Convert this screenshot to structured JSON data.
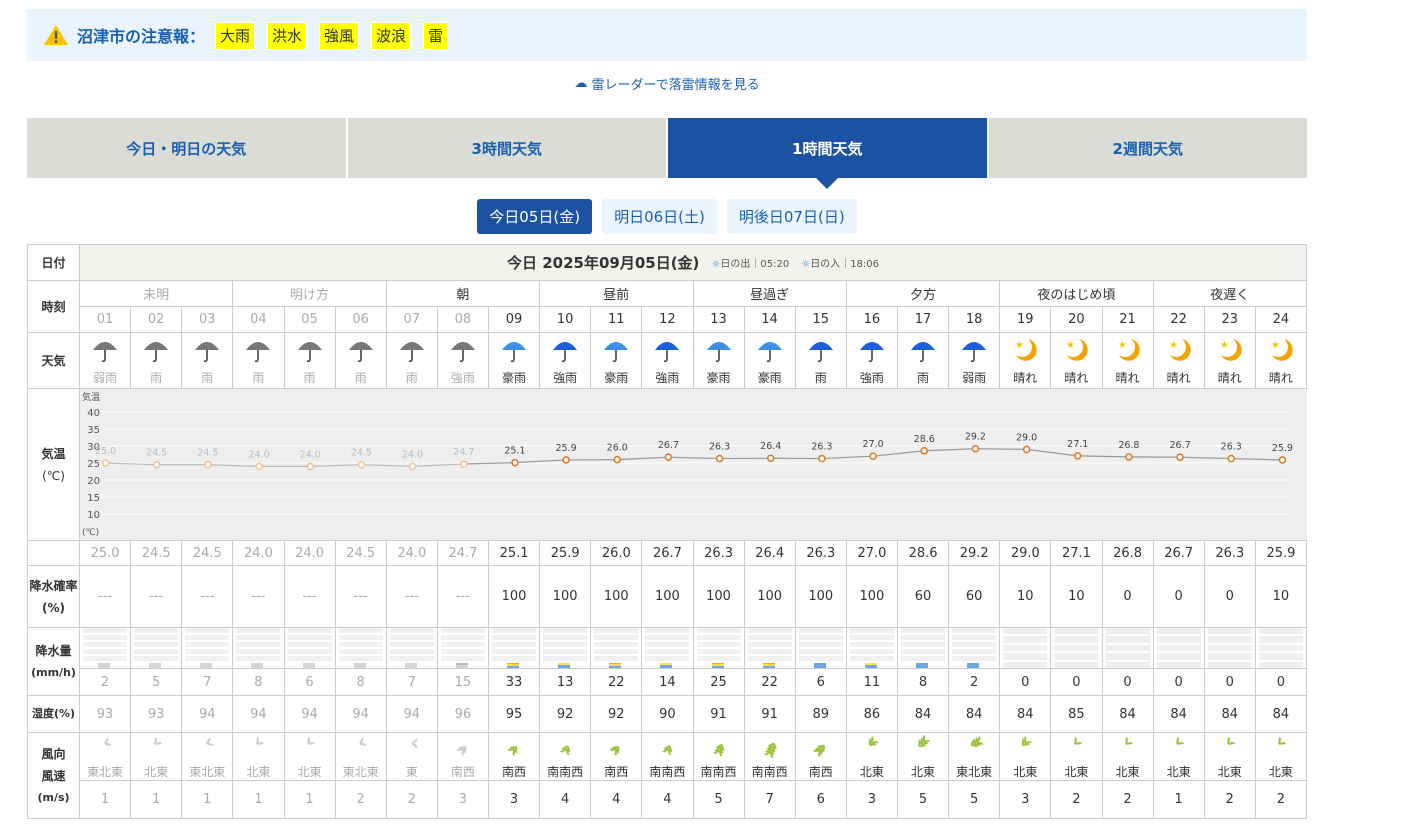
{
  "alert": {
    "title": "沼津市の注意報：",
    "tags": [
      "大雨",
      "洪水",
      "強風",
      "波浪",
      "雷"
    ]
  },
  "radar_link": "雷レーダーで落雷情報を見る",
  "tabs": [
    {
      "label": "今日・明日の天気"
    },
    {
      "label": "3時間天気"
    },
    {
      "label": "1時間天気",
      "active": true
    },
    {
      "label": "2週間天気"
    }
  ],
  "days": [
    {
      "label": "今日05日(金)",
      "active": true
    },
    {
      "label": "明日06日(土)"
    },
    {
      "label": "明後日07日(日)"
    }
  ],
  "labels": {
    "date": "日付",
    "time": "時刻",
    "weather": "天気",
    "temp": "気温",
    "temp_unit": "(℃)",
    "pop": "降水確率",
    "pop_unit": "(%)",
    "precip": "降水量",
    "precip_unit": "(mm/h)",
    "humidity": "湿度(%)",
    "wind_dir": "風向",
    "wind_speed": "風速",
    "wind_unit": "(m/s)"
  },
  "date": {
    "title": "今日 2025年09月05日(金)",
    "sunrise_label": "日の出",
    "sunrise": "05:20",
    "sunset_label": "日の入",
    "sunset": "18:06"
  },
  "periods": [
    {
      "label": "未明",
      "span": 3,
      "past": true
    },
    {
      "label": "明け方",
      "span": 3,
      "past": true
    },
    {
      "label": "朝",
      "span": 3
    },
    {
      "label": "昼前",
      "span": 3
    },
    {
      "label": "昼過ぎ",
      "span": 3
    },
    {
      "label": "夕方",
      "span": 3
    },
    {
      "label": "夜のはじめ頃",
      "span": 3
    },
    {
      "label": "夜遅く",
      "span": 3
    }
  ],
  "hours": [
    "01",
    "02",
    "03",
    "04",
    "05",
    "06",
    "07",
    "08",
    "09",
    "10",
    "11",
    "12",
    "13",
    "14",
    "15",
    "16",
    "17",
    "18",
    "19",
    "20",
    "21",
    "22",
    "23",
    "24"
  ],
  "past_count": 8,
  "weather": [
    "弱雨",
    "雨",
    "雨",
    "雨",
    "雨",
    "雨",
    "雨",
    "強雨",
    "豪雨",
    "強雨",
    "豪雨",
    "強雨",
    "豪雨",
    "豪雨",
    "雨",
    "強雨",
    "雨",
    "弱雨",
    "晴れ",
    "晴れ",
    "晴れ",
    "晴れ",
    "晴れ",
    "晴れ"
  ],
  "chart_data": {
    "type": "line",
    "title": "気温",
    "ylabel": "(℃)",
    "yticks": [
      10,
      15,
      20,
      25,
      30,
      35,
      40
    ],
    "ylim": [
      5,
      45
    ],
    "x": [
      "01",
      "02",
      "03",
      "04",
      "05",
      "06",
      "07",
      "08",
      "09",
      "10",
      "11",
      "12",
      "13",
      "14",
      "15",
      "16",
      "17",
      "18",
      "19",
      "20",
      "21",
      "22",
      "23",
      "24"
    ],
    "values": [
      25.0,
      24.5,
      24.5,
      24.0,
      24.0,
      24.5,
      24.0,
      24.7,
      25.1,
      25.9,
      26.0,
      26.7,
      26.3,
      26.4,
      26.3,
      27.0,
      28.6,
      29.2,
      29.0,
      27.1,
      26.8,
      26.7,
      26.3,
      25.9
    ],
    "labels": [
      "25.0",
      "24.5",
      "24.5",
      "24.0",
      "24.0",
      "24.5",
      "24.0",
      "24.7",
      "25.1",
      "25.9",
      "26.0",
      "26.7",
      "26.3",
      "26.4",
      "26.3",
      "27.0",
      "28.6",
      "29.2",
      "29.0",
      "27.1",
      "26.8",
      "26.7",
      "26.3",
      "25.9"
    ]
  },
  "pop": [
    "---",
    "---",
    "---",
    "---",
    "---",
    "---",
    "---",
    "---",
    "100",
    "100",
    "100",
    "100",
    "100",
    "100",
    "100",
    "100",
    "60",
    "60",
    "10",
    "10",
    "0",
    "0",
    "0",
    "10"
  ],
  "precip": [
    "2",
    "5",
    "7",
    "8",
    "6",
    "8",
    "7",
    "15",
    "33",
    "13",
    "22",
    "14",
    "25",
    "22",
    "6",
    "11",
    "8",
    "2",
    "0",
    "0",
    "0",
    "0",
    "0",
    "0"
  ],
  "humidity": [
    "93",
    "93",
    "94",
    "94",
    "94",
    "94",
    "94",
    "96",
    "95",
    "92",
    "92",
    "90",
    "91",
    "91",
    "89",
    "86",
    "84",
    "84",
    "84",
    "85",
    "84",
    "84",
    "84",
    "84"
  ],
  "wind_dir": [
    "東北東",
    "北東",
    "東北東",
    "北東",
    "北東",
    "東北東",
    "東",
    "南西",
    "南西",
    "南南西",
    "南西",
    "南南西",
    "南南西",
    "南南西",
    "南西",
    "北東",
    "北東",
    "東北東",
    "北東",
    "北東",
    "北東",
    "北東",
    "北東",
    "北東"
  ],
  "wind_speed": [
    "1",
    "1",
    "1",
    "1",
    "1",
    "2",
    "2",
    "3",
    "3",
    "4",
    "4",
    "4",
    "5",
    "7",
    "6",
    "3",
    "5",
    "5",
    "3",
    "2",
    "2",
    "1",
    "2",
    "2"
  ],
  "colors": {
    "accent": "#1c52a2",
    "link": "#1a5fb4",
    "rain_blue": "#6ea6e8",
    "rain_yellow": "#ffdd55",
    "rain_orange": "#f8a020",
    "wind_green": "#9ac43a",
    "temp_orange": "#e07d28"
  }
}
